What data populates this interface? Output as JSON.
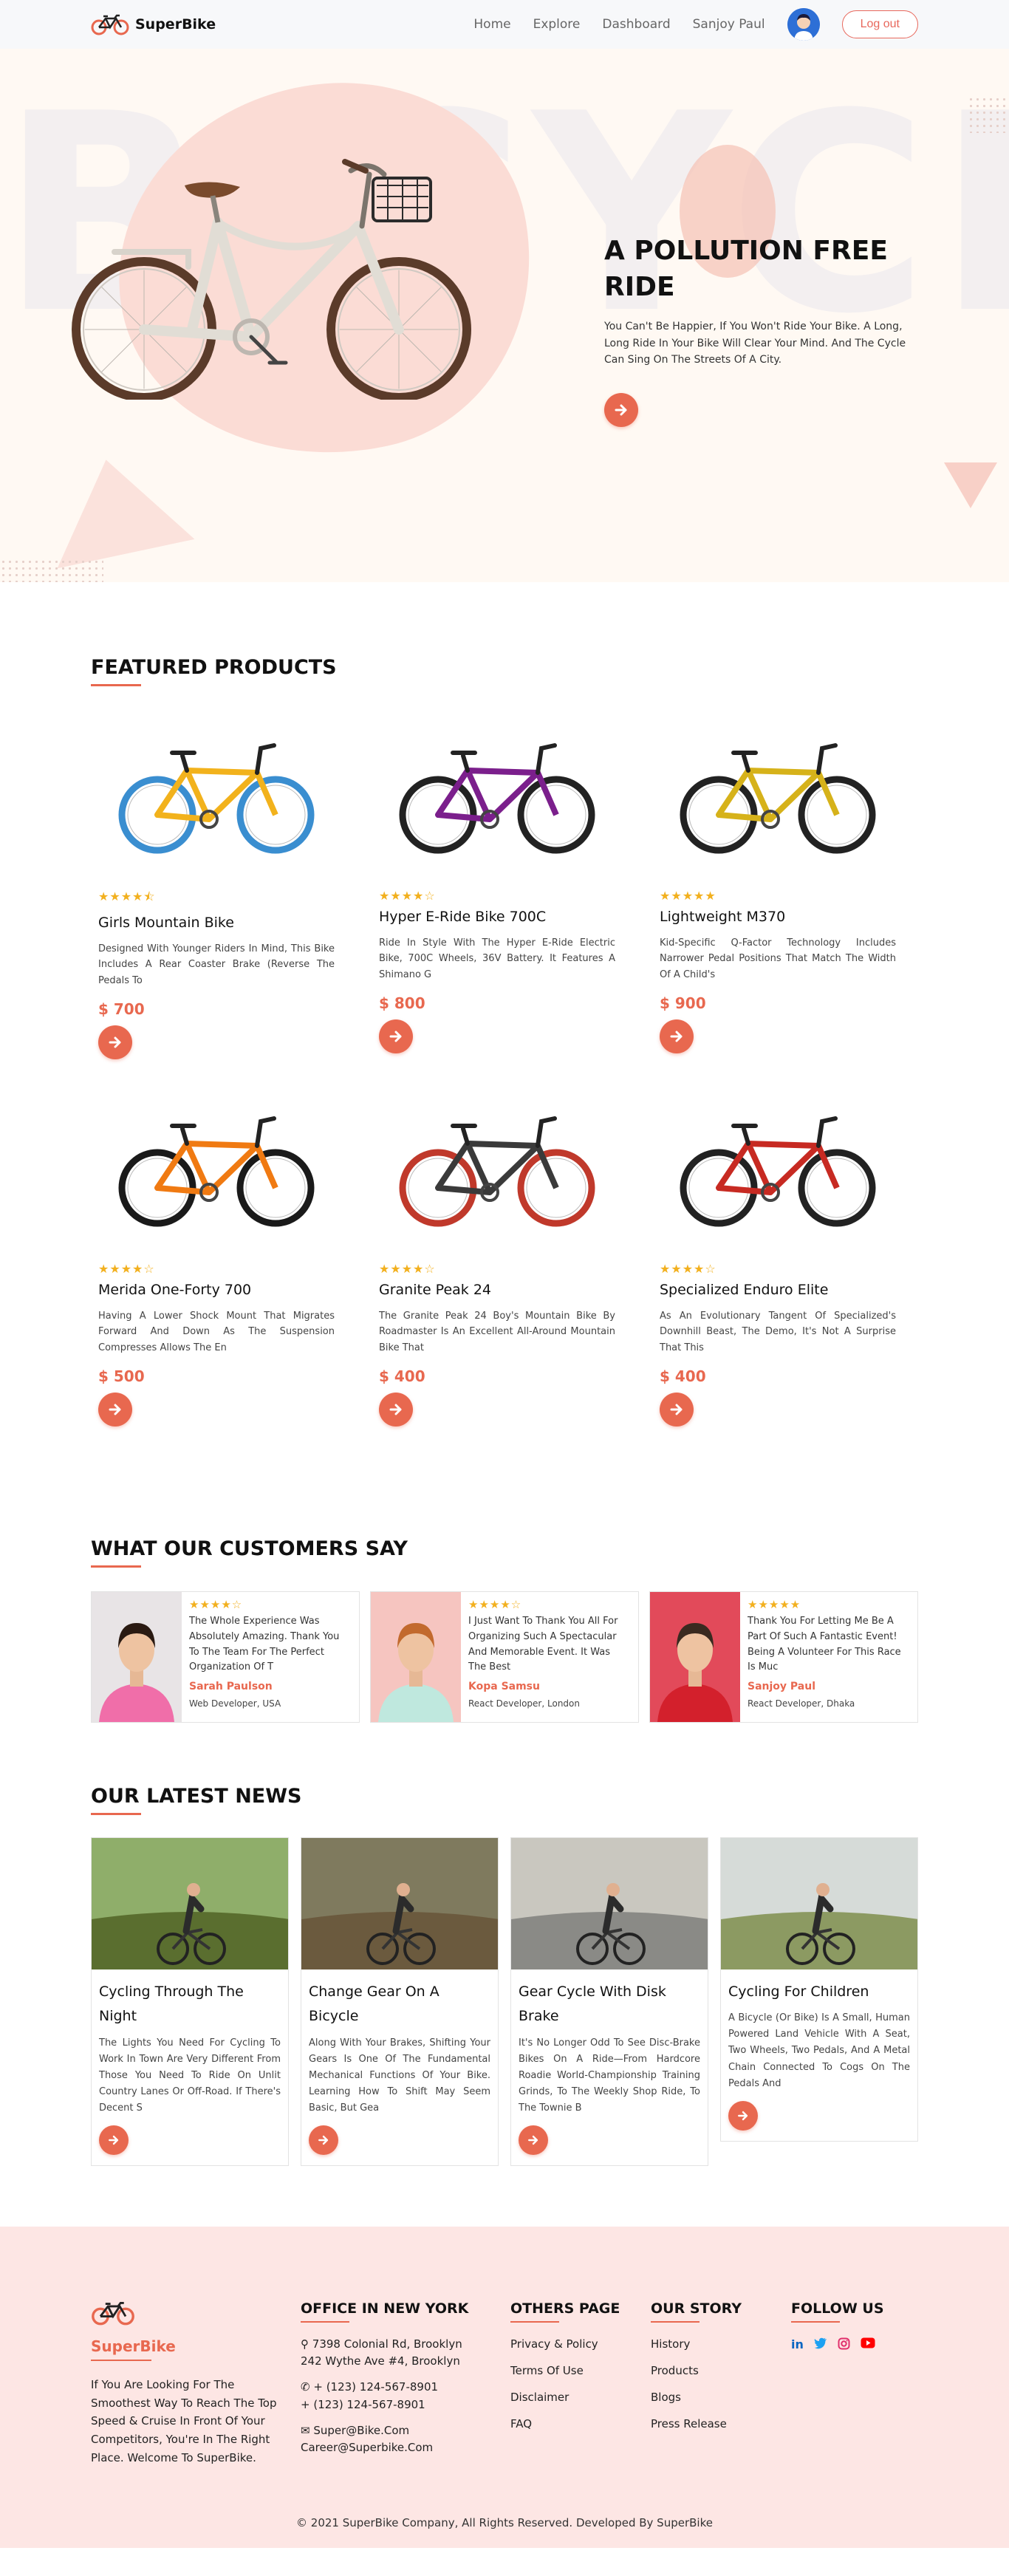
{
  "brand": {
    "name": "SuperBike"
  },
  "nav": {
    "links": [
      "Home",
      "Explore",
      "Dashboard"
    ],
    "user_name": "Sanjoy Paul",
    "logout_label": "Log out"
  },
  "hero": {
    "background_text": "BICYCLE",
    "title": "A POLLUTION FREE RIDE",
    "text": "You Can't Be Happier, If You Won't Ride Your Bike. A Long, Long Ride In Your Bike Will Clear Your Mind. And The Cycle Can Sing On The Streets Of A City.",
    "button_icon": "arrow-right-icon"
  },
  "featured": {
    "title": "FEATURED PRODUCTS",
    "products": [
      {
        "name": "Girls Mountain Bike",
        "rating": 4.5,
        "stars": "★★★★⯪",
        "description": "Designed With Younger Riders In Mind, This Bike Includes A Rear Coaster Brake (Reverse The Pedals To",
        "price": "$ 700",
        "color": "#f2b21c",
        "accent": "#3a8ed0"
      },
      {
        "name": "Hyper E-Ride Bike 700C",
        "rating": 4,
        "stars": "★★★★☆",
        "description": "Ride In Style With The Hyper E-Ride Electric Bike, 700C Wheels, 36V Battery. It Features A Shimano G",
        "price": "$ 800",
        "color": "#7b1f8c",
        "accent": "#222222"
      },
      {
        "name": "Lightweight M370",
        "rating": 5,
        "stars": "★★★★★",
        "description": "Kid-Specific Q-Factor Technology Includes Narrower Pedal Positions That Match The Width Of A Child's",
        "price": "$ 900",
        "color": "#d6b21a",
        "accent": "#222222"
      },
      {
        "name": "Merida One-Forty 700",
        "rating": 4,
        "stars": "★★★★☆",
        "description": "Having A Lower Shock Mount That Migrates Forward And Down As The Suspension Compresses Allows The En",
        "price": "$ 500",
        "color": "#f07a12",
        "accent": "#1a1a1a"
      },
      {
        "name": "Granite Peak 24",
        "rating": 4,
        "stars": "★★★★☆",
        "description": "The Granite Peak 24 Boy's Mountain Bike By Roadmaster Is An Excellent All-Around Mountain Bike That",
        "price": "$ 400",
        "color": "#3a3a3a",
        "accent": "#c0392b"
      },
      {
        "name": "Specialized Enduro Elite",
        "rating": 4,
        "stars": "★★★★☆",
        "description": "As An Evolutionary Tangent Of Specialized's Downhill Beast, The Demo, It's Not A Surprise That This",
        "price": "$ 400",
        "color": "#c72a22",
        "accent": "#222222"
      }
    ]
  },
  "testimonials": {
    "title": "WHAT OUR CUSTOMERS SAY",
    "items": [
      {
        "stars": "★★★★☆",
        "rating": 4,
        "quote": "The Whole Experience Was Absolutely Amazing. Thank You To The Team For The Perfect Organization Of T",
        "name": "Sarah Paulson",
        "role": "Web Developer, USA",
        "photo_bg": "#e8e4e6",
        "shirt": "#f06ea9"
      },
      {
        "stars": "★★★★☆",
        "rating": 4,
        "quote": "I Just Want To Thank You All For Organizing Such A Spectacular And Memorable Event. It Was The Best",
        "name": "Kopa Samsu",
        "role": "React Developer, London",
        "photo_bg": "#f6c5c0",
        "shirt": "#bfe8de"
      },
      {
        "stars": "★★★★★",
        "rating": 5,
        "quote": "Thank You For Letting Me Be A Part Of Such A Fantastic Event! Being A Volunteer For This Race Is Muc",
        "name": "Sanjoy Paul",
        "role": "React Developer, Dhaka",
        "photo_bg": "#e24a5a",
        "shirt": "#d3202c"
      }
    ]
  },
  "news": {
    "title": "OUR LATEST NEWS",
    "items": [
      {
        "title": "Cycling Through The Night",
        "text": "The Lights You Need For Cycling To Work In Town Are Very Different From Those You Need To Ride On Unlit Country Lanes Or Off-Road. If There's Decent S",
        "sky": "#8fae6a",
        "ground": "#5a6e2f"
      },
      {
        "title": "Change Gear On A Bicycle",
        "text": "Along With Your Brakes, Shifting Your Gears Is One Of The Fundamental Mechanical Functions Of Your Bike. Learning How To Shift May Seem Basic, But Gea",
        "sky": "#7f7a5e",
        "ground": "#6b5a3e"
      },
      {
        "title": "Gear Cycle With Disk Brake",
        "text": "It's No Longer Odd To See Disc-Brake Bikes On A Ride—From Hardcore Roadie World-Championship Training Grinds, To The Weekly Shop Ride, To The Townie B",
        "sky": "#c9c7bf",
        "ground": "#8a8a86"
      },
      {
        "title": "Cycling For Children",
        "text": "A Bicycle (Or Bike) Is A Small, Human Powered Land Vehicle With A Seat, Two Wheels, Two Pedals, And A Metal Chain Connected To Cogs On The Pedals And",
        "sky": "#d6dbd8",
        "ground": "#8c9a62"
      }
    ]
  },
  "footer": {
    "brand_text": "If You Are Looking For The Smoothest Way To Reach The Top Speed & Cruise In Front Of Your Competitors, You're In The Right Place. Welcome To SuperBike.",
    "office": {
      "title": "OFFICE IN NEW YORK",
      "address_1": "7398 Colonial Rd, Brooklyn",
      "address_2": "242 Wythe Ave #4, Brooklyn",
      "phone_1": "+ (123) 124-567-8901",
      "phone_2": "+ (123) 124-567-8901",
      "email_1": "Super@Bike.Com",
      "email_2": "Career@Superbike.Com"
    },
    "others": {
      "title": "OTHERS PAGE",
      "links": [
        "Privacy & Policy",
        "Terms Of Use",
        "Disclaimer",
        "FAQ"
      ]
    },
    "story": {
      "title": "OUR STORY",
      "links": [
        "History",
        "Products",
        "Blogs",
        "Press Release"
      ]
    },
    "follow": {
      "title": "FOLLOW US",
      "icons": [
        "linkedin-icon",
        "twitter-icon",
        "instagram-icon",
        "youtube-icon"
      ]
    },
    "copyright": "© 2021 SuperBike Company, All Rights Reserved. Developed By SuperBike"
  },
  "colors": {
    "accent": "#e8684f",
    "star": "#f2b01e",
    "hero_bg": "#fff9f3",
    "footer_bg": "#fde6e4"
  }
}
